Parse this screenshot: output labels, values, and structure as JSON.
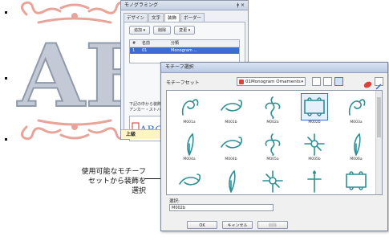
{
  "docker": {
    "title": "モノグラミング",
    "controls": "ǂ ×",
    "tabs": [
      "デザイン",
      "文字",
      "装飾",
      "ボーダー"
    ],
    "active_tab": 2,
    "buttons": [
      "追加 ▾",
      "削除",
      "変更 ▾"
    ],
    "columns": [
      "#",
      "名前",
      "分類"
    ],
    "rows": [
      {
        "num": "1",
        "name": "01",
        "category": "Monogram ..."
      }
    ],
    "footer_text": [
      "下記の中から装飾を",
      "アンカー・ストハイライ"
    ],
    "advanced_label": "上級"
  },
  "dialog": {
    "title": "モチーフ選択",
    "set_label": "モチーフセット",
    "set_value": "01Monogram Ornaments",
    "motifs": [
      {
        "label": "M001a",
        "kind": "swirl"
      },
      {
        "label": "M001b",
        "kind": "scroll"
      },
      {
        "label": "M002a",
        "kind": "flourish"
      },
      {
        "label": "M002b",
        "kind": "frame",
        "selected": true
      },
      {
        "label": "M003a",
        "kind": "swirl"
      },
      {
        "label": "M004a",
        "kind": "leaf"
      },
      {
        "label": "M004b",
        "kind": "scroll"
      },
      {
        "label": "M005a",
        "kind": "flourish"
      },
      {
        "label": "M005b",
        "kind": "floral"
      },
      {
        "label": "M006a",
        "kind": "leaf"
      },
      {
        "label": "",
        "kind": "scroll"
      },
      {
        "label": "",
        "kind": "leaf"
      },
      {
        "label": "",
        "kind": "floral"
      },
      {
        "label": "",
        "kind": "cross"
      },
      {
        "label": "",
        "kind": "frame"
      }
    ],
    "selection_label": "選択:",
    "selection_value": "M002b",
    "ok": "OK",
    "cancel": "キャンセル",
    "delete": "削除"
  },
  "callout": {
    "line1": "使用可能なモチーフ",
    "line2": "セットから装飾を",
    "line3": "選択"
  },
  "artwork": {
    "letters": "AB",
    "letter_color": "#b9c2cf",
    "ornament_color": "#e9a49a"
  },
  "colors": {
    "motif_stroke": "#2f8f95",
    "selection": "#3a6fd1"
  }
}
